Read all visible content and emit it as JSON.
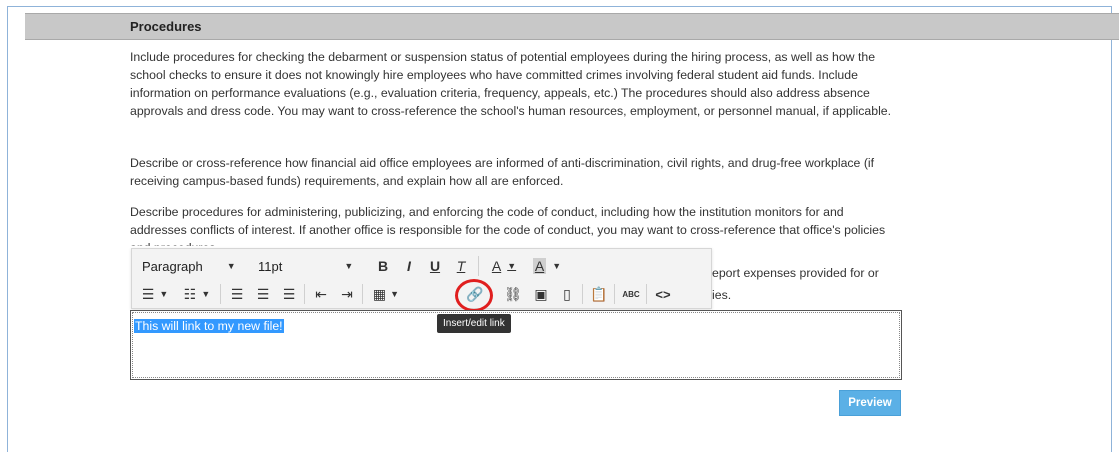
{
  "section": {
    "title": "Procedures"
  },
  "paragraphs": [
    "Include procedures for checking the debarment or suspension status of potential employees during the hiring process, as well as how the school checks to ensure it does not knowingly hire employees who have committed crimes involving federal student aid funds. Include information on performance evaluations (e.g., evaluation criteria, frequency, appeals, etc.) The procedures should also address absence approvals and dress code. You may want to cross-reference the school's human resources, employment, or personnel manual, if applicable.",
    "Describe or cross-reference how financial aid office employees are informed of anti-discrimination, civil rights, and drug-free workplace (if receiving campus-based funds) requirements, and explain how all are enforced.",
    "Describe procedures for administering, publicizing, and enforcing the code of conduct, including how the institution monitors for and addresses conflicts of interest. If another office is responsible for the code of conduct, you may want to cross-reference that office's policies and procedures.",
    "eport expenses provided for or",
    "ies."
  ],
  "toolbar": {
    "format_select": "Paragraph",
    "font_size_select": "11pt",
    "bold": "B",
    "italic": "I",
    "underline": "U",
    "clear_format": "T",
    "font_color": "A",
    "bg_color": "A",
    "source_code": "<>",
    "spellcheck": "ABC"
  },
  "editor": {
    "content": "This will link to my new file!"
  },
  "tooltip": {
    "text": "Insert/edit link"
  },
  "actions": {
    "preview_label": "Preview"
  },
  "colors": {
    "header_bg": "#c8c8c8",
    "selection": "#3399ff",
    "preview_button": "#5bb0e6",
    "highlight_ring": "#e01f1f"
  }
}
